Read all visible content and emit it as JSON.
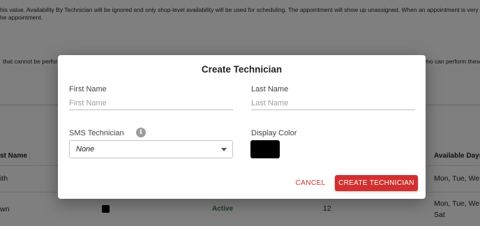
{
  "background": {
    "intro_line1": "his value, Availability By Technician will be ignored and only shop-level availability will be used for scheduling. The appointment will show up unassigned. When an appointment is very l",
    "intro_line2": "he appointment.",
    "left_snippet": "that cannot be perfor",
    "right_snippet": "who can perform these",
    "table": {
      "col_name": "st Name",
      "col_days": "Available Days",
      "rows": [
        {
          "name": "ith",
          "days": "Mon, Tue, We"
        },
        {
          "name": "wn",
          "status": "Active",
          "count": "12",
          "days": "Mon, Tue, We",
          "days_line2": "Sat"
        }
      ]
    }
  },
  "dialog": {
    "title": "Create Technician",
    "first_name": {
      "label": "First Name",
      "placeholder": "First Name",
      "value": ""
    },
    "last_name": {
      "label": "Last Name",
      "placeholder": "Last Name",
      "value": ""
    },
    "sms": {
      "label": "SMS Technician",
      "info_icon": "info-icon",
      "selected": "None"
    },
    "display_color": {
      "label": "Display Color",
      "value": "#000000"
    },
    "cancel_label": "CANCEL",
    "create_label": "CREATE TECHNICIAN"
  },
  "colors": {
    "primary": "#d32f2f",
    "active_status": "#2e7d32",
    "scrim": "rgba(0,0,0,0.5)"
  }
}
